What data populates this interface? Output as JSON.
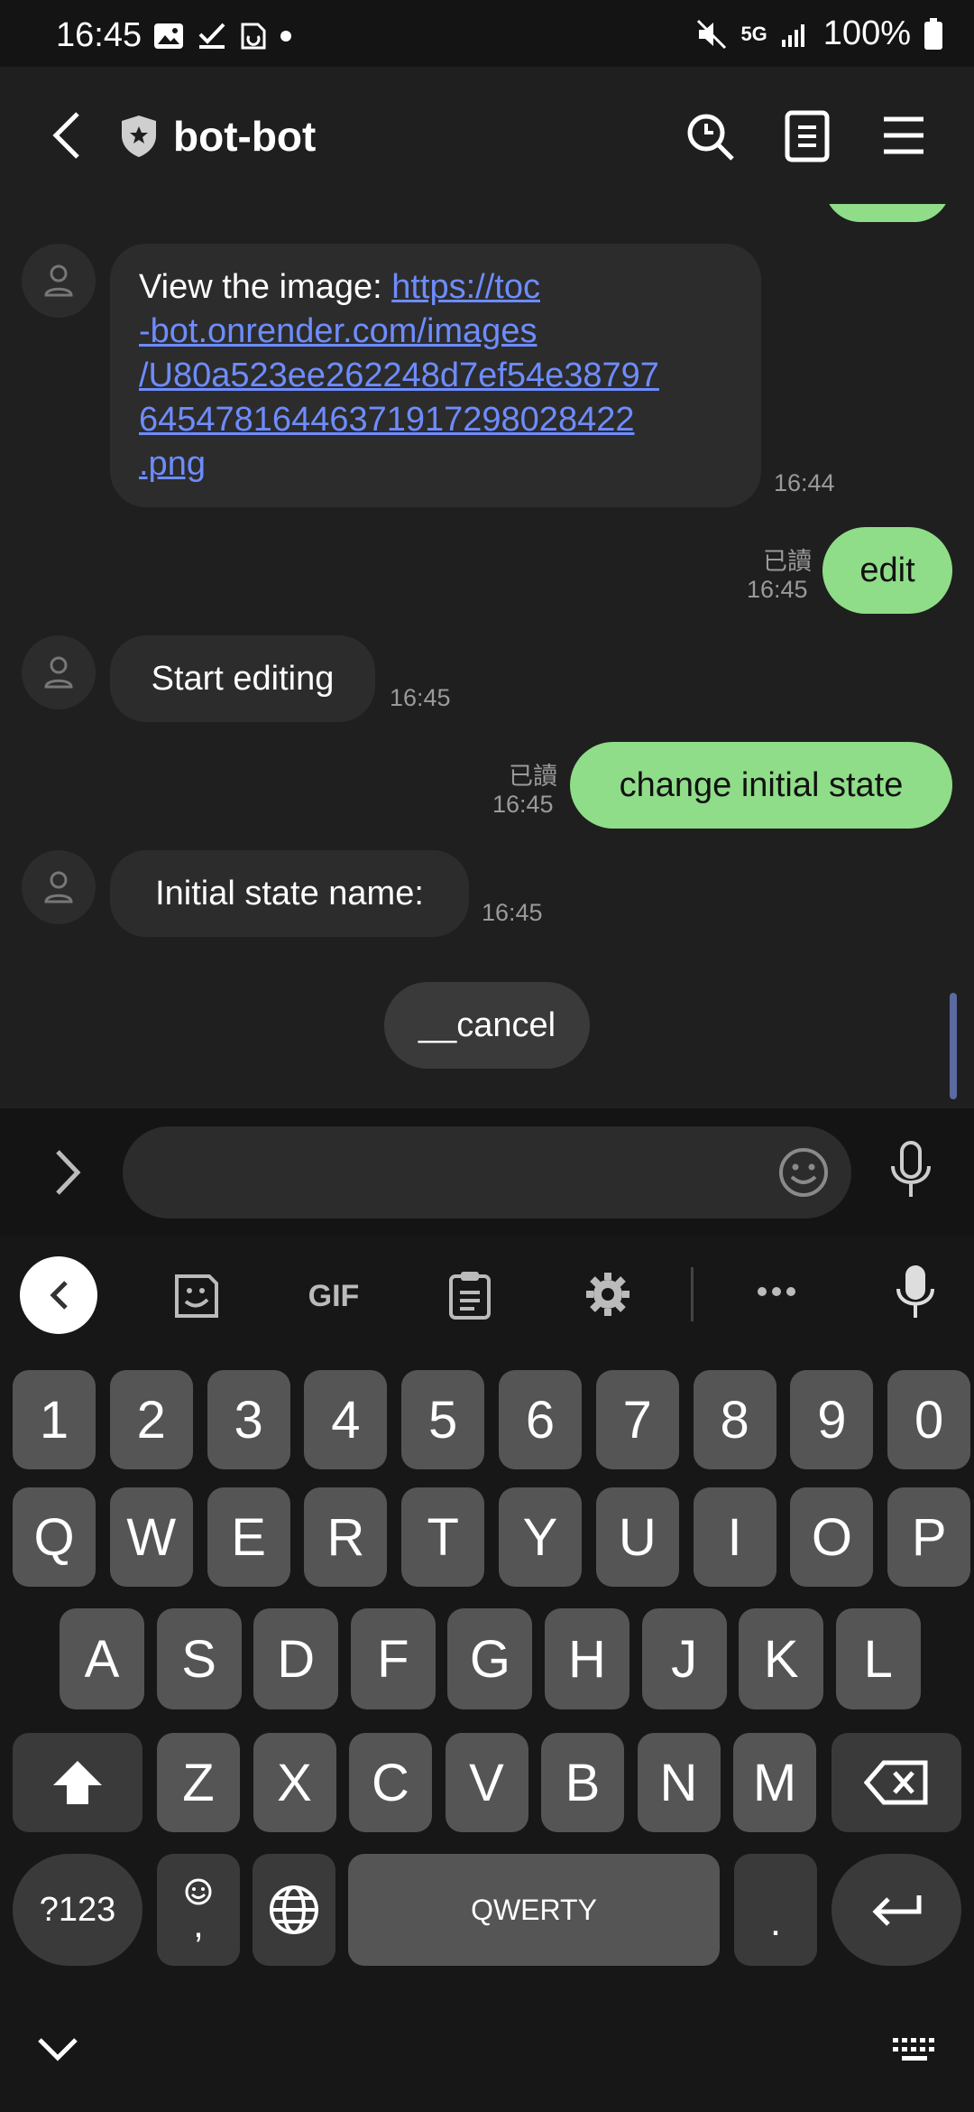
{
  "status_bar": {
    "time": "16:45",
    "network": "5G",
    "battery": "100%"
  },
  "header": {
    "title": "bot-bot"
  },
  "messages": [
    {
      "type": "incoming",
      "text_prefix": "View the image: ",
      "link_lines": [
        "https://toc",
        "-bot.onrender.com/images",
        "/U80a523ee262248d7ef54e38797",
        "64547816446371917298028422",
        ".png"
      ],
      "time": "16:44"
    },
    {
      "type": "outgoing",
      "text": "edit",
      "read": "已讀",
      "time": "16:45"
    },
    {
      "type": "incoming",
      "text": "Start editing",
      "time": "16:45"
    },
    {
      "type": "outgoing",
      "text": "change initial state",
      "read": "已讀",
      "time": "16:45"
    },
    {
      "type": "incoming",
      "text": "Initial state name:",
      "time": "16:45"
    }
  ],
  "quick_reply": {
    "label": "__cancel"
  },
  "input": {
    "placeholder": ""
  },
  "keyboard": {
    "toolbar": {
      "gif": "GIF"
    },
    "number_row": [
      "1",
      "2",
      "3",
      "4",
      "5",
      "6",
      "7",
      "8",
      "9",
      "0"
    ],
    "row1": [
      "Q",
      "W",
      "E",
      "R",
      "T",
      "Y",
      "U",
      "I",
      "O",
      "P"
    ],
    "row2": [
      "A",
      "S",
      "D",
      "F",
      "G",
      "H",
      "J",
      "K",
      "L"
    ],
    "row3": [
      "Z",
      "X",
      "C",
      "V",
      "B",
      "N",
      "M"
    ],
    "symbols_label": "?123",
    "comma": ",",
    "space_label": "QWERTY",
    "period": "."
  },
  "colors": {
    "outgoing_bubble": "#8fdd88",
    "incoming_bubble": "#2c2c2c",
    "link": "#6e8cff"
  }
}
